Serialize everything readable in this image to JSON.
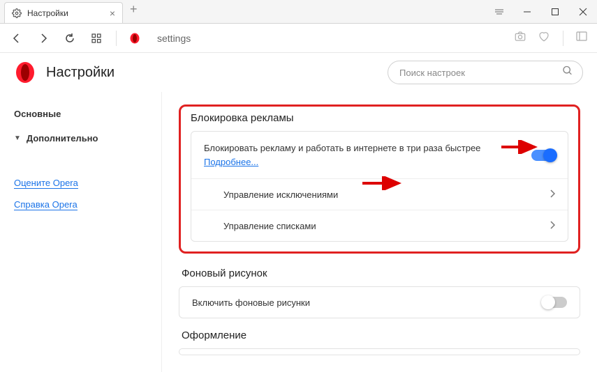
{
  "tab": {
    "title": "Настройки"
  },
  "address": "settings",
  "header": {
    "title": "Настройки",
    "search_placeholder": "Поиск настроек"
  },
  "sidebar": {
    "basic": "Основные",
    "advanced": "Дополнительно",
    "rate": "Оцените Opera",
    "help": "Справка Opera"
  },
  "sections": {
    "adblock": {
      "title": "Блокировка рекламы",
      "desc": "Блокировать рекламу и работать в интернете в три раза быстрее  ",
      "more": "Подробнее...",
      "exceptions": "Управление исключениями",
      "lists": "Управление списками"
    },
    "wallpaper": {
      "title": "Фоновый рисунок",
      "enable": "Включить фоновые рисунки"
    },
    "appearance": {
      "title": "Оформление"
    }
  }
}
